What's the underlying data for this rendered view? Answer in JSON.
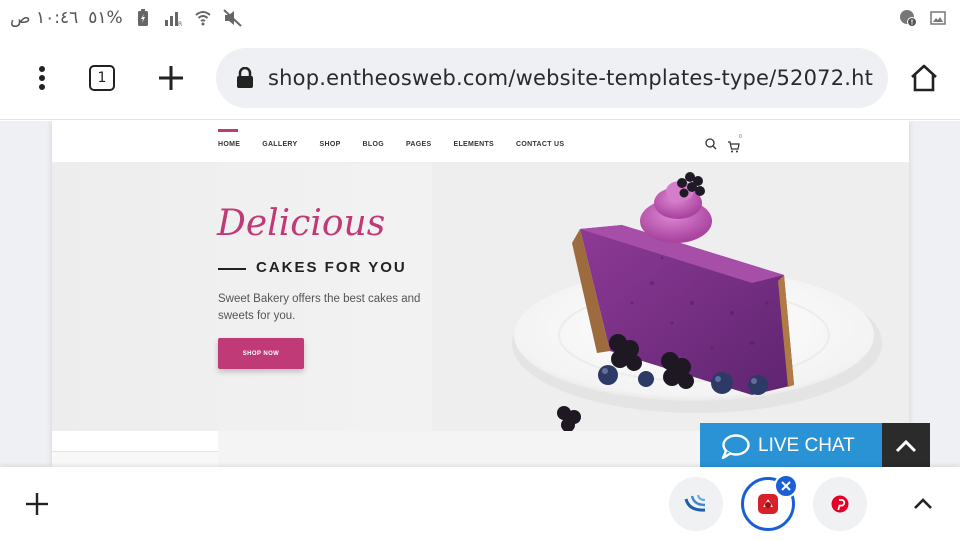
{
  "status_bar": {
    "time": "١٠:٤٦ ص",
    "battery": "٥١%"
  },
  "browser": {
    "tab_count": "1",
    "url": "shop.entheosweb.com/website-templates-type/52072.ht"
  },
  "site": {
    "nav": [
      "HOME",
      "GALLERY",
      "SHOP",
      "BLOG",
      "PAGES",
      "ELEMENTS",
      "CONTACT US"
    ],
    "cart_count": "0",
    "hero": {
      "script_title": "Delicious",
      "title": "CAKES FOR YOU",
      "description": "Sweet Bakery offers the best cakes and sweets for you.",
      "button": "SHOP NOW"
    },
    "accent_color": "#c03a78"
  },
  "live_chat": {
    "label": "LIVE CHAT",
    "color": "#2a93d5"
  },
  "bottom_bar": {
    "apps": [
      "jquery-app-icon",
      "red-app-icon",
      "pinterest-icon"
    ]
  }
}
